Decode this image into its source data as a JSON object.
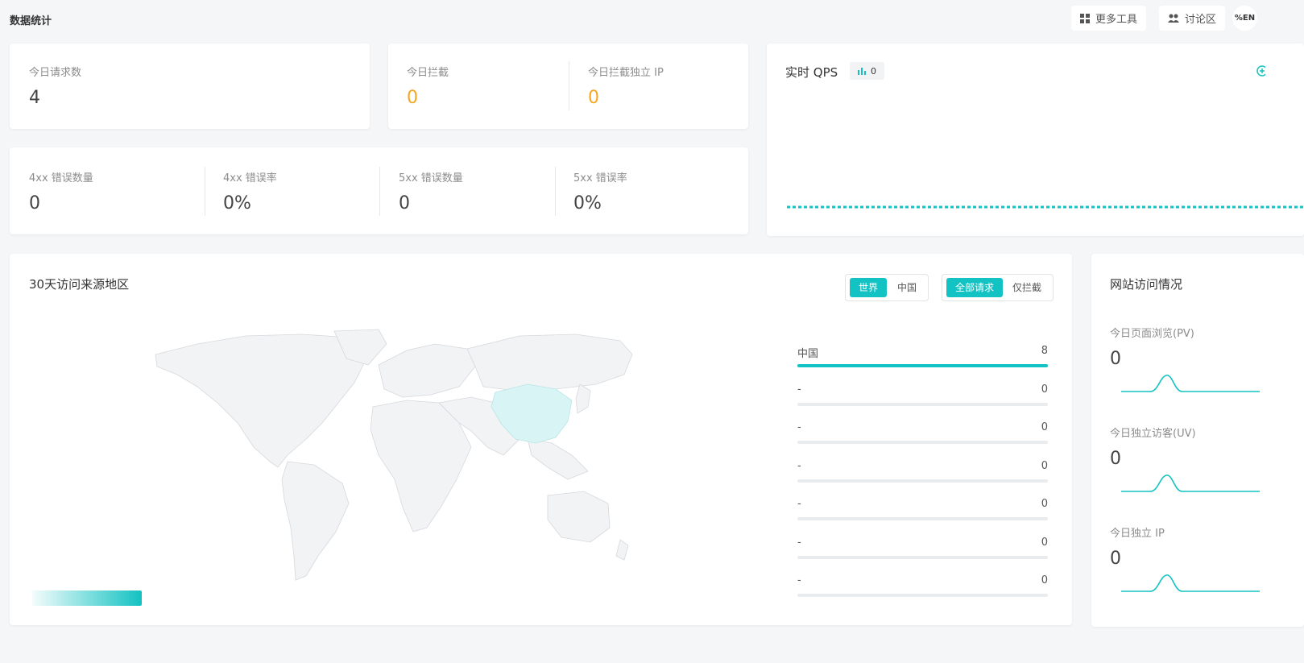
{
  "header": {
    "title": "数据统计",
    "more_tools": "更多工具",
    "discussion": "讨论区",
    "lang_icon_text": "%EN"
  },
  "stats": {
    "today_requests": {
      "label": "今日请求数",
      "value": "4"
    },
    "today_blocked": {
      "label": "今日拦截",
      "value": "0"
    },
    "today_blocked_ip": {
      "label": "今日拦截独立 IP",
      "value": "0"
    },
    "err4xx_count": {
      "label": "4xx 错误数量",
      "value": "0"
    },
    "err4xx_rate": {
      "label": "4xx 错误率",
      "value": "0%"
    },
    "err5xx_count": {
      "label": "5xx 错误数量",
      "value": "0"
    },
    "err5xx_rate": {
      "label": "5xx 错误率",
      "value": "0%"
    }
  },
  "qps": {
    "title": "实时 QPS",
    "badge_value": "0"
  },
  "region": {
    "title": "30天访问来源地区",
    "scope_tabs": [
      "世界",
      "中国"
    ],
    "scope_active": 0,
    "filter_tabs": [
      "全部请求",
      "仅拦截"
    ],
    "filter_active": 0,
    "ranking": [
      {
        "name": "中国",
        "value": "8",
        "fill": 1.0
      },
      {
        "name": "-",
        "value": "0",
        "fill": 0
      },
      {
        "name": "-",
        "value": "0",
        "fill": 0
      },
      {
        "name": "-",
        "value": "0",
        "fill": 0
      },
      {
        "name": "-",
        "value": "0",
        "fill": 0
      },
      {
        "name": "-",
        "value": "0",
        "fill": 0
      },
      {
        "name": "-",
        "value": "0",
        "fill": 0
      }
    ]
  },
  "site": {
    "title": "网站访问情况",
    "pv": {
      "label": "今日页面浏览(PV)",
      "value": "0"
    },
    "uv": {
      "label": "今日独立访客(UV)",
      "value": "0"
    },
    "ip": {
      "label": "今日独立 IP",
      "value": "0"
    }
  },
  "colors": {
    "accent": "#13c2c2",
    "warning": "#f5a623",
    "china_fill": "#d9f4f4",
    "map_land": "#f2f3f5"
  }
}
